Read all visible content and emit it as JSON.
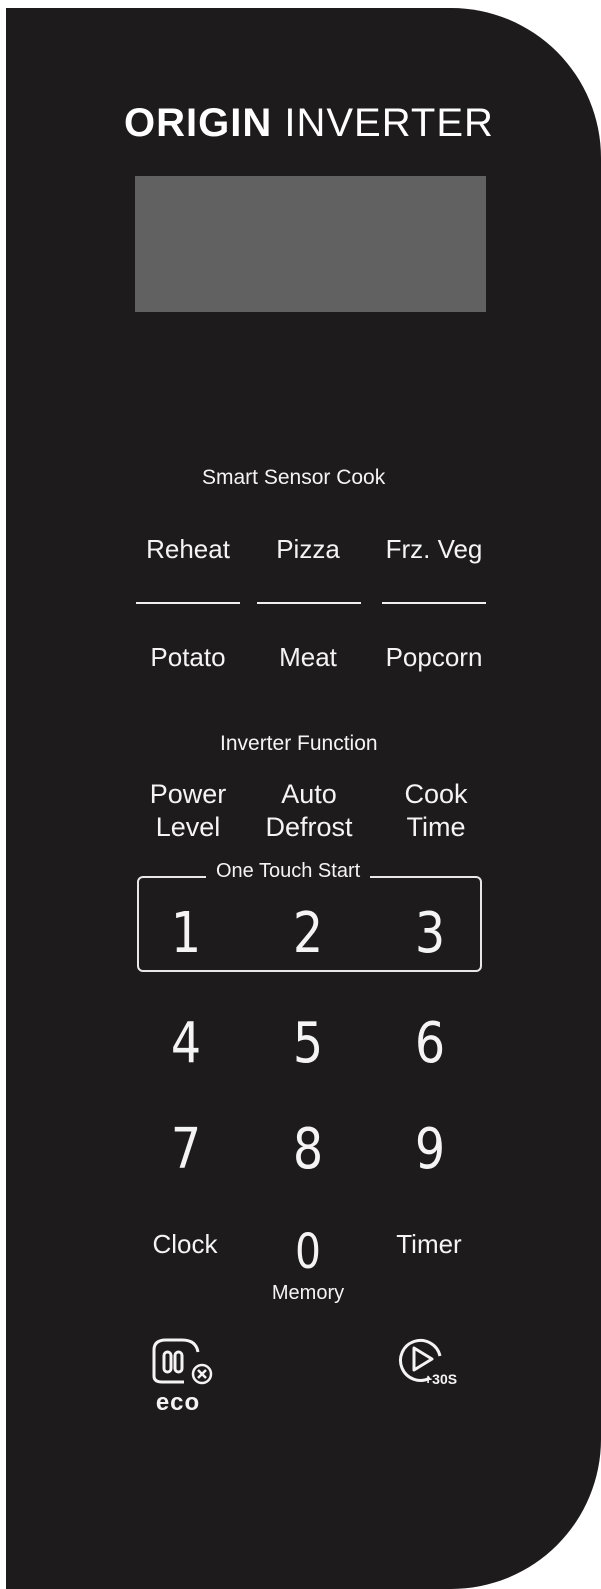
{
  "brand": {
    "bold": "ORIGIN",
    "light": "INVERTER"
  },
  "sensor": {
    "title": "Smart Sensor Cook",
    "row1": [
      "Reheat",
      "Pizza",
      "Frz. Veg"
    ],
    "row2": [
      "Potato",
      "Meat",
      "Popcorn"
    ]
  },
  "inverter": {
    "title": "Inverter Function",
    "power_level": {
      "line1": "Power",
      "line2": "Level"
    },
    "auto_defrost": {
      "line1": "Auto",
      "line2": "Defrost"
    },
    "cook_time": {
      "line1": "Cook",
      "line2": "Time"
    }
  },
  "keypad": {
    "one_touch_label": "One Touch Start",
    "digits": [
      "1",
      "2",
      "3",
      "4",
      "5",
      "6",
      "7",
      "8",
      "9",
      "0"
    ],
    "clock": "Clock",
    "timer": "Timer",
    "memory": "Memory"
  },
  "bottom": {
    "eco_label": "eco",
    "plus30_label": "+30S",
    "eco_icon": "eco-stop-icon",
    "start_icon": "start-plus30-icon"
  },
  "colors": {
    "panel": "#1d1b1c",
    "display": "#616161",
    "text": "#f4f4f4"
  }
}
